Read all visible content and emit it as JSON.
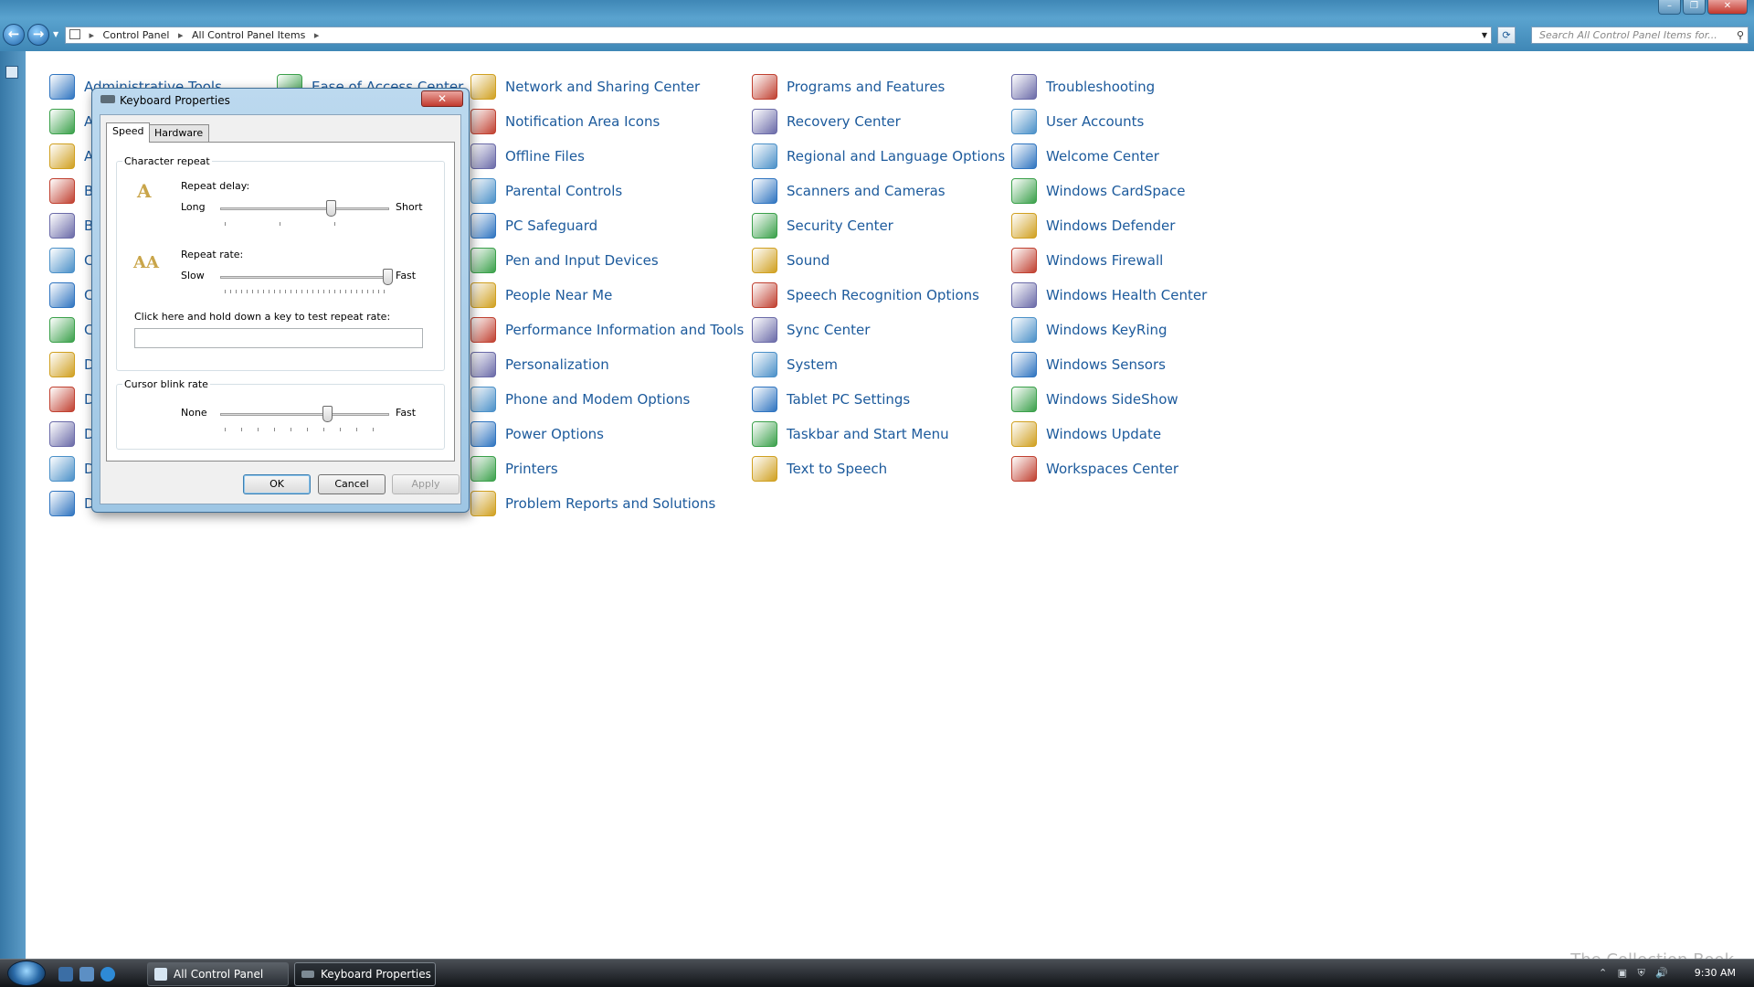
{
  "address": {
    "crumbs": [
      "Control Panel",
      "All Control Panel Items"
    ],
    "search_placeholder": "Search All Control Panel Items for..."
  },
  "control_panel": {
    "col1": [
      "Administrative Tools",
      "A",
      "A",
      "B",
      "B",
      "C",
      "C",
      "C",
      "D",
      "D",
      "D",
      "D",
      "D"
    ],
    "col2": [
      "Ease of Access Center"
    ],
    "col3": [
      "Network and Sharing Center",
      "Notification Area Icons",
      "Offline Files",
      "Parental Controls",
      "PC Safeguard",
      "Pen and Input Devices",
      "People Near Me",
      "Performance Information and Tools",
      "Personalization",
      "Phone and Modem Options",
      "Power Options",
      "Printers",
      "Problem Reports and Solutions"
    ],
    "col4": [
      "Programs and Features",
      "Recovery Center",
      "Regional and Language Options",
      "Scanners and Cameras",
      "Security Center",
      "Sound",
      "Speech Recognition Options",
      "Sync Center",
      "System",
      "Tablet PC Settings",
      "Taskbar and Start Menu",
      "Text to Speech"
    ],
    "col5": [
      "Troubleshooting",
      "User Accounts",
      "Welcome Center",
      "Windows CardSpace",
      "Windows Defender",
      "Windows Firewall",
      "Windows Health Center",
      "Windows KeyRing",
      "Windows Sensors",
      "Windows SideShow",
      "Windows Update",
      "Workspaces Center"
    ],
    "icon_colors": [
      "#2f74c0",
      "#3aa04a",
      "#d0a020",
      "#c04030",
      "#6a6aa8",
      "#4a90c8"
    ]
  },
  "dialog": {
    "title": "Keyboard Properties",
    "close": "✕",
    "tabs": [
      "Speed",
      "Hardware"
    ],
    "character_repeat": {
      "group_title": "Character repeat",
      "repeat_delay_label": "Repeat delay:",
      "repeat_delay_min": "Long",
      "repeat_delay_max": "Short",
      "repeat_delay_value": 0.65,
      "repeat_rate_label": "Repeat rate:",
      "repeat_rate_min": "Slow",
      "repeat_rate_max": "Fast",
      "repeat_rate_value": 1.0,
      "test_prompt": "Click here and hold down a key to test repeat rate:"
    },
    "cursor_blink": {
      "group_title": "Cursor blink rate",
      "min": "None",
      "max": "Fast",
      "value": 0.63
    },
    "buttons": {
      "ok": "OK",
      "cancel": "Cancel",
      "apply": "Apply"
    }
  },
  "taskbar": {
    "tasks": [
      "All Control Panel Ite...",
      "Keyboard Properties"
    ],
    "clock": "9:30 AM"
  },
  "watermark": "The Collection Book"
}
